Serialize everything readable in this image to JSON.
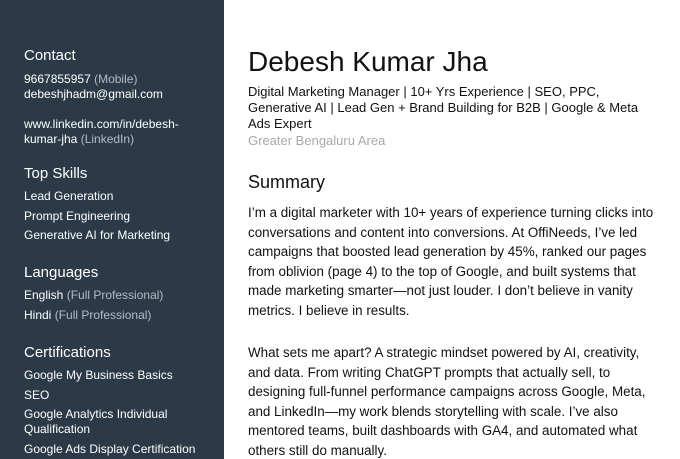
{
  "sidebar": {
    "contact": {
      "heading": "Contact",
      "phone": "9667855957",
      "phone_label": "(Mobile)",
      "email": "debeshjhadm@gmail.com",
      "linkedin_line1": "www.linkedin.com/in/debesh-",
      "linkedin_line2": "kumar-jha",
      "linkedin_label": "(LinkedIn)"
    },
    "top_skills": {
      "heading": "Top Skills",
      "items": [
        "Lead Generation",
        "Prompt Engineering",
        "Generative AI for Marketing"
      ]
    },
    "languages": {
      "heading": "Languages",
      "items": [
        {
          "name": "English",
          "level": "(Full Professional)"
        },
        {
          "name": "Hindi",
          "level": "(Full Professional)"
        }
      ]
    },
    "certifications": {
      "heading": "Certifications",
      "items": [
        "Google My Business Basics",
        "SEO",
        "Google Analytics Individual",
        "Qualification",
        "Google Ads Display Certification"
      ]
    }
  },
  "main": {
    "name": "Debesh Kumar Jha",
    "headline_lines": [
      "Digital Marketing Manager | 10+ Yrs Experience | SEO, PPC,",
      "Generative AI | Lead Gen + Brand Building for B2B | Google & Meta",
      "Ads Expert"
    ],
    "location": "Greater Bengaluru Area",
    "summary_heading": "Summary",
    "summary_p1_lines": [
      "I’m a digital marketer with 10+ years of experience turning clicks into",
      "conversations and content into conversions. At OffiNeeds, I’ve led",
      "campaigns that boosted lead generation by 45%, ranked our pages",
      "from oblivion (page 4) to the top of Google, and built systems that",
      "made marketing smarter—not just louder. I don’t believe in vanity",
      "metrics. I believe in results."
    ],
    "summary_p2_lines": [
      "What sets me apart? A strategic mindset powered by AI, creativity,",
      "and data. From writing ChatGPT prompts that actually sell, to",
      "designing full-funnel performance campaigns across Google, Meta,",
      "and LinkedIn—my work blends storytelling with scale. I’ve also",
      "mentored teams, built dashboards with GA4, and automated what",
      "others still do manually."
    ]
  }
}
